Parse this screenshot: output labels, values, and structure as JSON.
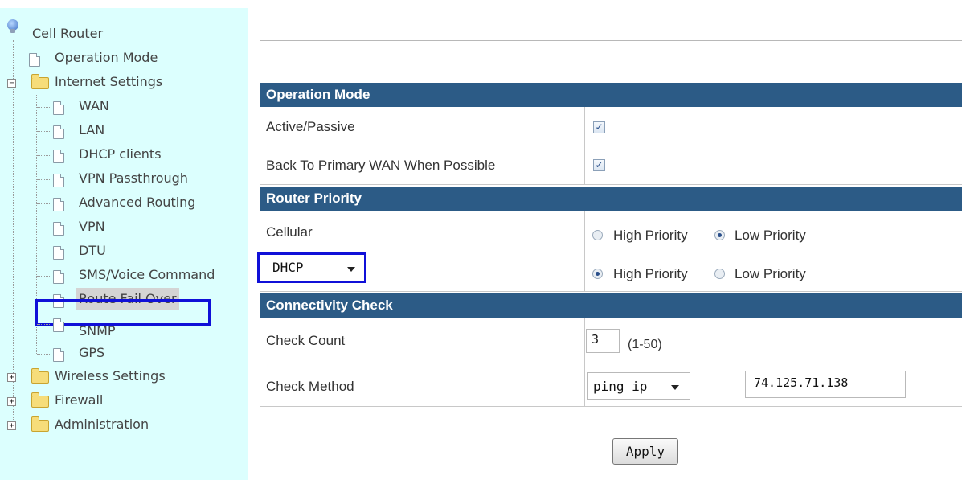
{
  "tree": {
    "root": "Cell Router",
    "operation_mode": "Operation Mode",
    "internet_settings": "Internet Settings",
    "children": [
      "WAN",
      "LAN",
      "DHCP clients",
      "VPN Passthrough",
      "Advanced Routing",
      "VPN",
      "DTU",
      "SMS/Voice Command",
      "Route Fail Over",
      "SNMP",
      "GPS"
    ],
    "wireless_settings": "Wireless Settings",
    "firewall": "Firewall",
    "administration": "Administration",
    "selected": "Route Fail Over"
  },
  "operation_mode": {
    "header": "Operation Mode",
    "active_passive_label": "Active/Passive",
    "active_passive_checked": true,
    "back_to_primary_label": "Back To Primary WAN When Possible",
    "back_to_primary_checked": true
  },
  "router_priority": {
    "header": "Router Priority",
    "cellular_label": "Cellular",
    "cellular_priority": "Low Priority",
    "dhcp_select": "DHCP",
    "dhcp_priority": "High Priority",
    "high_label": "High Priority",
    "low_label": "Low Priority"
  },
  "connectivity_check": {
    "header": "Connectivity Check",
    "check_count_label": "Check Count",
    "check_count_value": "3",
    "check_count_range": "(1-50)",
    "check_method_label": "Check Method",
    "check_method_value": "ping ip",
    "ip_value": "74.125.71.138"
  },
  "apply_label": "Apply",
  "colors": {
    "sidebar_bg": "#dcfffe",
    "section_header": "#2c5b86",
    "highlight_border": "#1010d8"
  }
}
